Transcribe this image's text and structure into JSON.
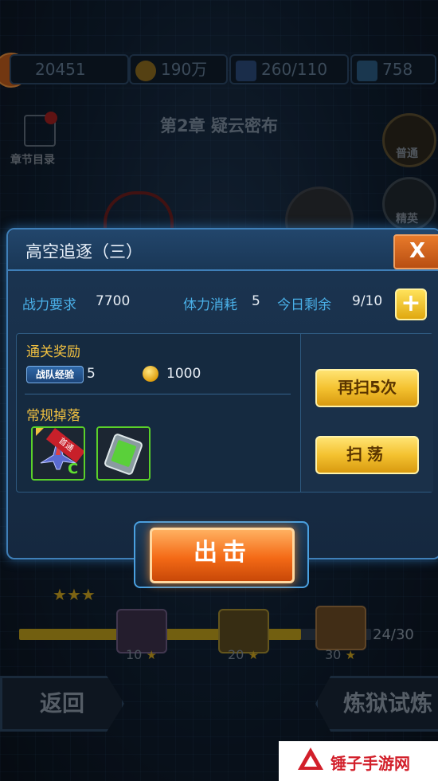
{
  "resources": {
    "power": "20451",
    "gold": "190万",
    "energy": "260/110",
    "diamond": "758"
  },
  "chapter": {
    "title": "第2章 疑云密布",
    "catalog_label": "章节目录",
    "normal_label": "普通",
    "elite_label": "精英"
  },
  "dialog": {
    "title": "高空追逐（三）",
    "close_label": "X",
    "power_req_label": "战力要求",
    "power_req_value": "7700",
    "stamina_label": "体力消耗",
    "stamina_value": "5",
    "remaining_label": "今日剩余",
    "remaining_value": "9/10",
    "plus_label": "+",
    "reward_title": "通关奖励",
    "team_exp_badge": "战队经验",
    "team_exp_value": "5",
    "gold_reward_value": "1000",
    "drop_title": "常规掉落",
    "first_clear_tag": "首通",
    "item_grade": "C",
    "sweep5_label": "再扫5次",
    "sweep_label": "扫荡"
  },
  "attack_label": "出击",
  "progress": {
    "text": "24/30",
    "fraction": 0.8,
    "milestones": [
      "10",
      "20",
      "30"
    ]
  },
  "bottom": {
    "back_label": "返回",
    "trial_label": "炼狱试炼"
  },
  "watermark": {
    "text": "锤子手游网"
  },
  "colors": {
    "accent_blue": "#4ab0e8",
    "gold_text": "#f0c040",
    "orange_button": "#f46a16"
  }
}
